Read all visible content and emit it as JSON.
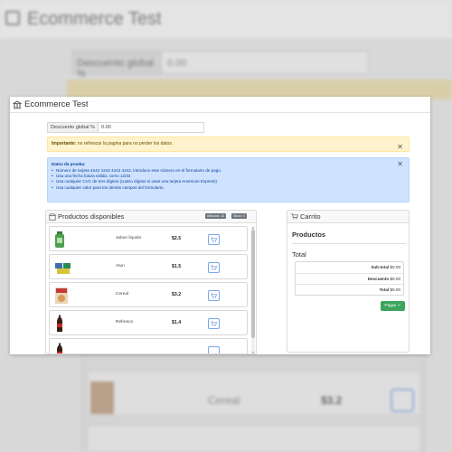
{
  "app": {
    "title": "Ecommerce Test"
  },
  "discount": {
    "label": "Descuento global %",
    "value": "0.00"
  },
  "warning": {
    "strong": "Importante:",
    "text": " no refrescar la pagina para no perder los datos."
  },
  "info": {
    "title": "Datos de prueba:",
    "items": [
      "Número de tarjeta 4242 4242 4242 4242, introduce este número en el formulario de pago.",
      "Usa una fecha futura válida, como 12/34",
      "Usa cualquier CVC de tres dígitos (cuatro dígitos si usas una tarjeta American Express)",
      "Usa cualquier valor para los demás campos del formulario."
    ]
  },
  "products": {
    "title": "Productos disponibles",
    "badges": [
      "Articulos: 10",
      "Stock: 0"
    ],
    "items": [
      {
        "name": "Jabon liquido",
        "price": "$2.5"
      },
      {
        "name": "Atun",
        "price": "$1.5"
      },
      {
        "name": "Cereal",
        "price": "$3.2"
      },
      {
        "name": "Refresco",
        "price": "$1.4"
      }
    ]
  },
  "cart": {
    "title": "Carrito",
    "products_title": "Productos",
    "total_title": "Total",
    "subtotal_label": "Sub-total",
    "subtotal_value": "$0.00",
    "discount_label": "Descuento",
    "discount_value": "$0.00",
    "total_label": "Total",
    "total_value": "$0.00",
    "pay_label": "Pagar"
  },
  "background": {
    "title": "Ecommerce Test",
    "discount_label": "Descuento global %",
    "discount_value": "0.00",
    "item_name": "Cereal",
    "item_price": "$3.2"
  },
  "colors": {
    "warning": "#fff3cd",
    "info": "#cfe2ff",
    "pay": "#3ca55c",
    "accent": "#7aa7e8"
  }
}
